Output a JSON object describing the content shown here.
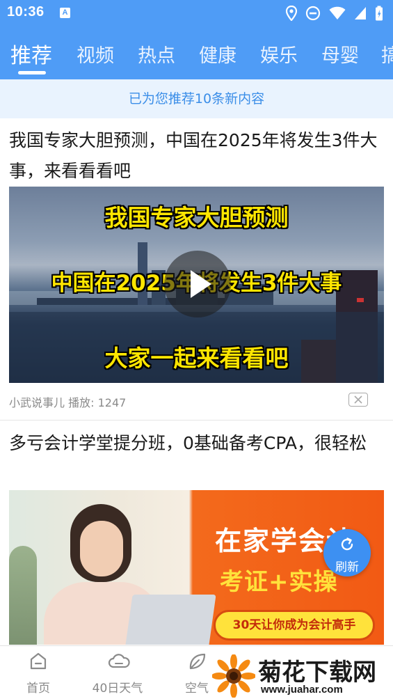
{
  "status_bar": {
    "time": "10:36",
    "notification_letter": "A",
    "icons": [
      "location-icon",
      "do-not-disturb-icon",
      "wifi-icon",
      "signal-icon",
      "battery-icon"
    ]
  },
  "tabs": [
    {
      "label": "推荐",
      "active": true
    },
    {
      "label": "视频"
    },
    {
      "label": "热点"
    },
    {
      "label": "健康"
    },
    {
      "label": "娱乐"
    },
    {
      "label": "母婴"
    },
    {
      "label": "搞"
    }
  ],
  "banner": {
    "text": "已为您推荐10条新内容"
  },
  "articles": [
    {
      "title": "我国专家大胆预测，中国在2025年将发生3件大事，来看看看吧",
      "thumb_lines": [
        "我国专家大胆预测",
        "中国在2025年将发生3件大事",
        "大家一起来看看吧"
      ],
      "source": "小武说事儿",
      "plays_label": "播放: 1247",
      "has_video": true
    },
    {
      "title": "多亏会计学堂提分班，0基础备考CPA，很轻松",
      "thumb_lines": [
        "在家学会计",
        "考证+实操",
        "30天让你成为会计高手"
      ]
    }
  ],
  "refresh_button": {
    "label": "刷新"
  },
  "bottom_nav": [
    {
      "label": "首页",
      "icon": "home-icon"
    },
    {
      "label": "40日天气",
      "icon": "cloud-icon"
    },
    {
      "label": "空气",
      "icon": "leaf-icon"
    }
  ],
  "watermark": {
    "text": "菊花下载网",
    "url": "www.juahar.com"
  },
  "colors": {
    "primary": "#4f9cf6",
    "banner_bg": "#e9f3fe",
    "banner_text": "#3b8ee8",
    "refresh": "#3d90f2"
  }
}
